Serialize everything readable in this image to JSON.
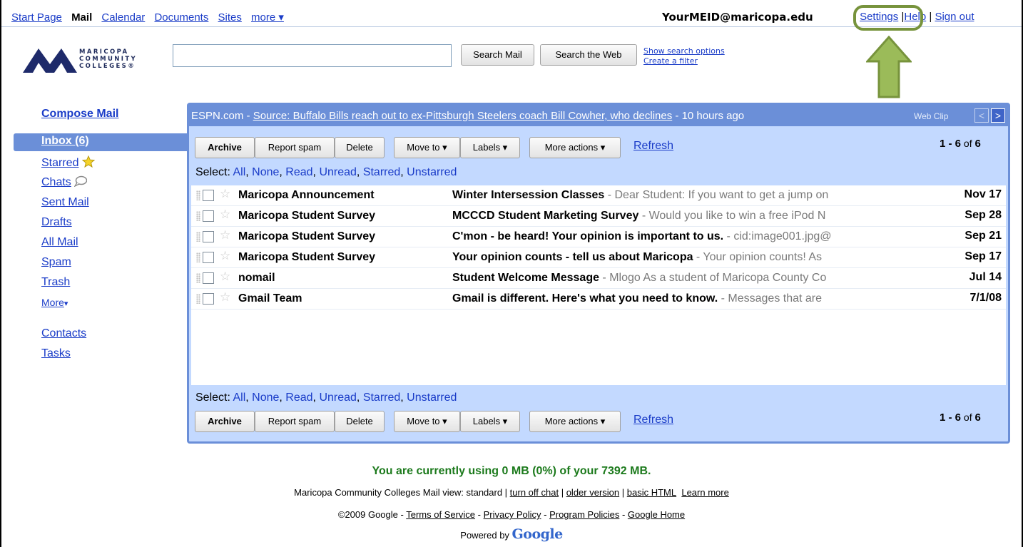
{
  "topnav": {
    "links": [
      "Start Page",
      "Mail",
      "Calendar",
      "Documents",
      "Sites",
      "more ▾"
    ],
    "email": "YourMEID@maricopa.edu",
    "settings": "Settings",
    "help": "Help",
    "signout": "Sign out",
    "accent_ring": "#77933c",
    "accent_arrow": "#9bbb59"
  },
  "logo": {
    "line1": "MARICOPA",
    "line2": "COMMUNITY",
    "line3": "COLLEGES®"
  },
  "search": {
    "value": "",
    "search_mail": "Search Mail",
    "search_web": "Search the Web",
    "show_options": "Show search options",
    "create_filter": "Create a filter"
  },
  "sidebar": {
    "compose": "Compose Mail",
    "inbox": "Inbox (6)",
    "starred": "Starred",
    "chats": "Chats",
    "sent": "Sent Mail",
    "drafts": "Drafts",
    "all": "All Mail",
    "spam": "Spam",
    "trash": "Trash",
    "more": "More",
    "contacts": "Contacts",
    "tasks": "Tasks"
  },
  "webclip": {
    "source": "ESPN.com",
    "dash1": " - ",
    "headline": "Source: Buffalo Bills reach out to ex-Pittsburgh Steelers coach Bill Cowher, who declines",
    "age": " - 10 hours ago",
    "label": "Web Clip"
  },
  "toolbar": {
    "archive": "Archive",
    "report_spam": "Report spam",
    "delete": "Delete",
    "move_to": "Move to ▾",
    "labels": "Labels ▾",
    "more_actions": "More actions ▾",
    "refresh": "Refresh",
    "count_range": "1 - 6",
    "count_of": " of ",
    "count_total": "6"
  },
  "select": {
    "prefix": "Select: ",
    "all": "All",
    "none": "None",
    "read": "Read",
    "unread": "Unread",
    "starred": "Starred",
    "unstarred": "Unstarred",
    "sep": ", "
  },
  "messages": [
    {
      "sender": "Maricopa Announcement",
      "subject": "Winter Intersession Classes",
      "snippet": " - Dear Student: If you want to get a jump on",
      "date": "Nov 17"
    },
    {
      "sender": "Maricopa Student Survey",
      "subject": "MCCCD Student Marketing Survey",
      "snippet": " - Would you like to win a free iPod N",
      "date": "Sep 28"
    },
    {
      "sender": "Maricopa Student Survey",
      "subject": "C'mon - be heard! Your opinion is important to us.",
      "snippet": " - cid:image001.jpg@",
      "date": "Sep 21"
    },
    {
      "sender": "Maricopa Student Survey",
      "subject": "Your opinion counts - tell us about Maricopa",
      "snippet": " - Your opinion counts! As",
      "date": "Sep 17"
    },
    {
      "sender": "nomail",
      "subject": "Student Welcome Message",
      "snippet": " - Mlogo As a student of Maricopa County Co",
      "date": "Jul 14"
    },
    {
      "sender": "Gmail Team",
      "subject": "Gmail is different. Here's what you need to know.",
      "snippet": " - Messages that are",
      "date": "7/1/08"
    }
  ],
  "footer": {
    "usage": "You are currently using 0 MB (0%) of your 7392 MB.",
    "view_prefix": "Maricopa Community Colleges Mail view: standard | ",
    "turn_off_chat": "turn off chat",
    "older_version": "older version",
    "basic_html": "basic HTML",
    "learn_more": "Learn more",
    "copyright": "©2009 Google - ",
    "tos": "Terms of Service",
    "privacy": "Privacy Policy",
    "program": "Program Policies",
    "google_home": "Google Home",
    "powered": "Powered by ",
    "google_logo": "Google"
  }
}
